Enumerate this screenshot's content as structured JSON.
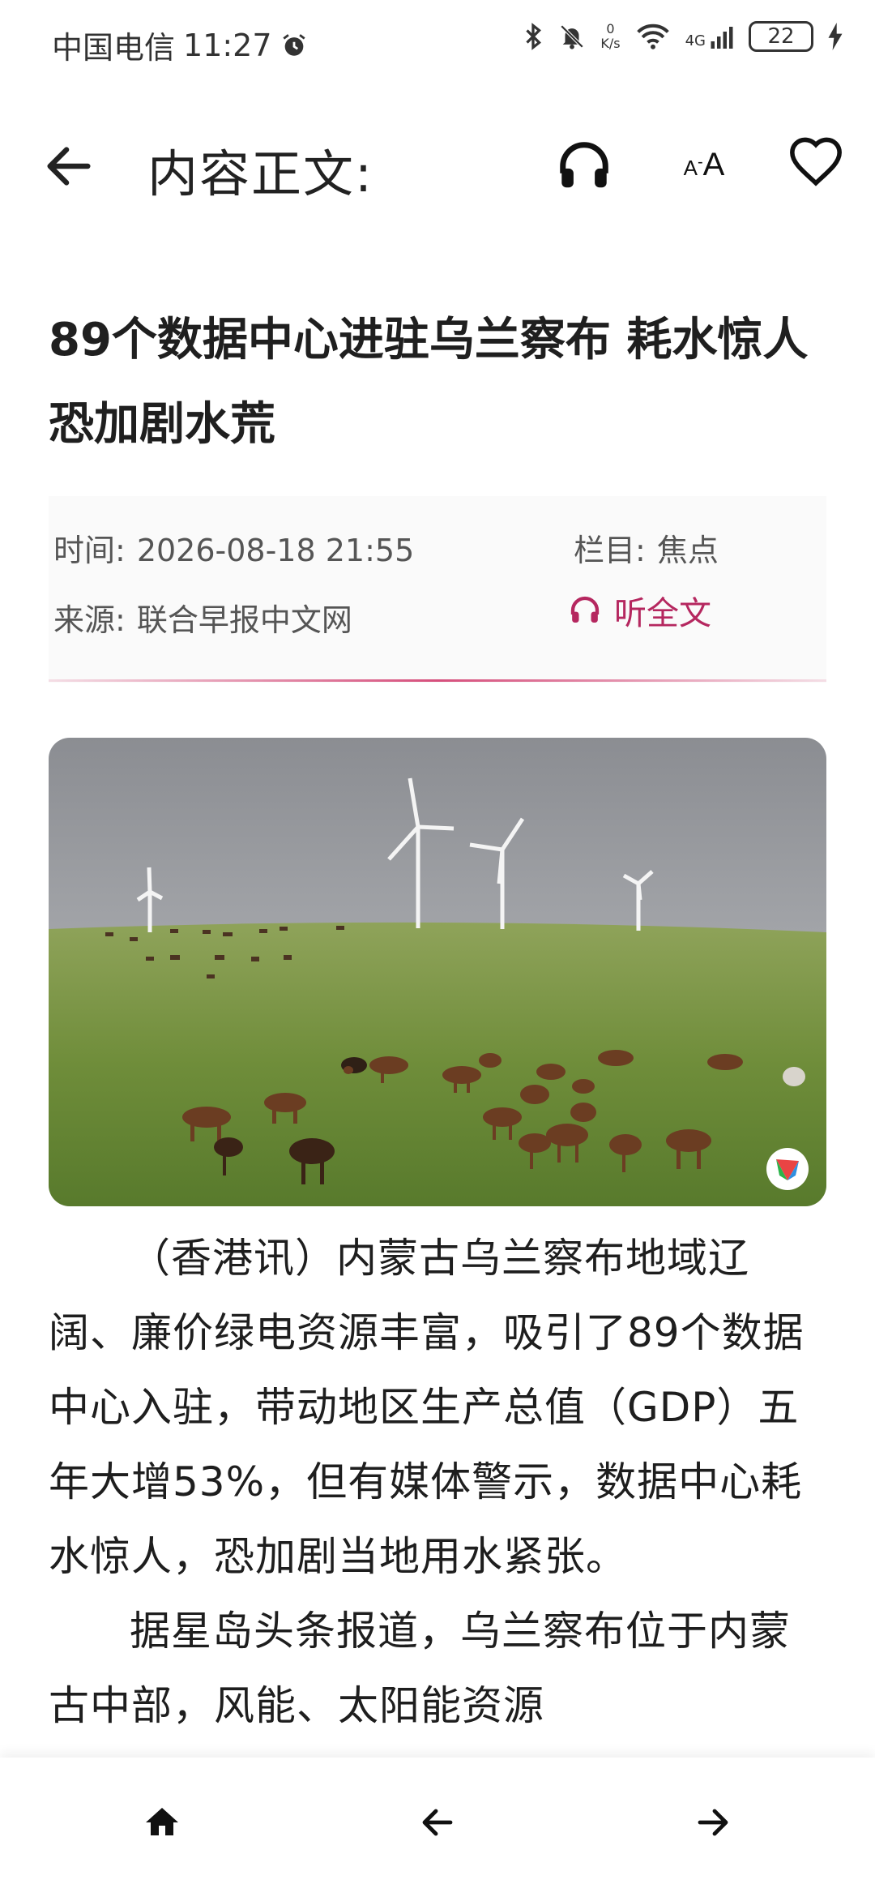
{
  "status_bar": {
    "carrier": "中国电信",
    "time": "11:27",
    "net_speed_value": "0",
    "net_speed_unit": "K/s",
    "network_type": "4G",
    "battery": "22"
  },
  "app_bar": {
    "title": "内容正文:",
    "font_button_label": "AA"
  },
  "article": {
    "headline": "89个数据中心进驻乌兰察布 耗水惊人恐加剧水荒",
    "meta": {
      "time_label": "时间:",
      "time_value": "2026-08-18 21:55",
      "column_label": "栏目:",
      "column_value": "焦点",
      "source_label": "来源:",
      "source_value": "联合早报中文网",
      "listen_label": "听全文"
    },
    "paragraphs": [
      "（香港讯）内蒙古乌兰察布地域辽阔、廉价绿电资源丰富，吸引了89个数据中心入驻，带动地区生产总值（GDP）五年大增53%，但有媒体警示，数据中心耗水惊人，恐加剧当地用水紧张。",
      "据星岛头条报道，乌兰察布位于内蒙古中部，风能、太阳能资源"
    ]
  },
  "colors": {
    "accent": "#b5275f",
    "text": "#1e1e1e",
    "meta_text": "#555555"
  },
  "icons": {
    "back": "arrow-left-icon",
    "listen": "headphones-icon",
    "font_size": "font-size-icon",
    "favorite": "heart-outline-icon",
    "home": "home-icon",
    "prev": "arrow-left-icon",
    "next": "arrow-right-icon"
  }
}
